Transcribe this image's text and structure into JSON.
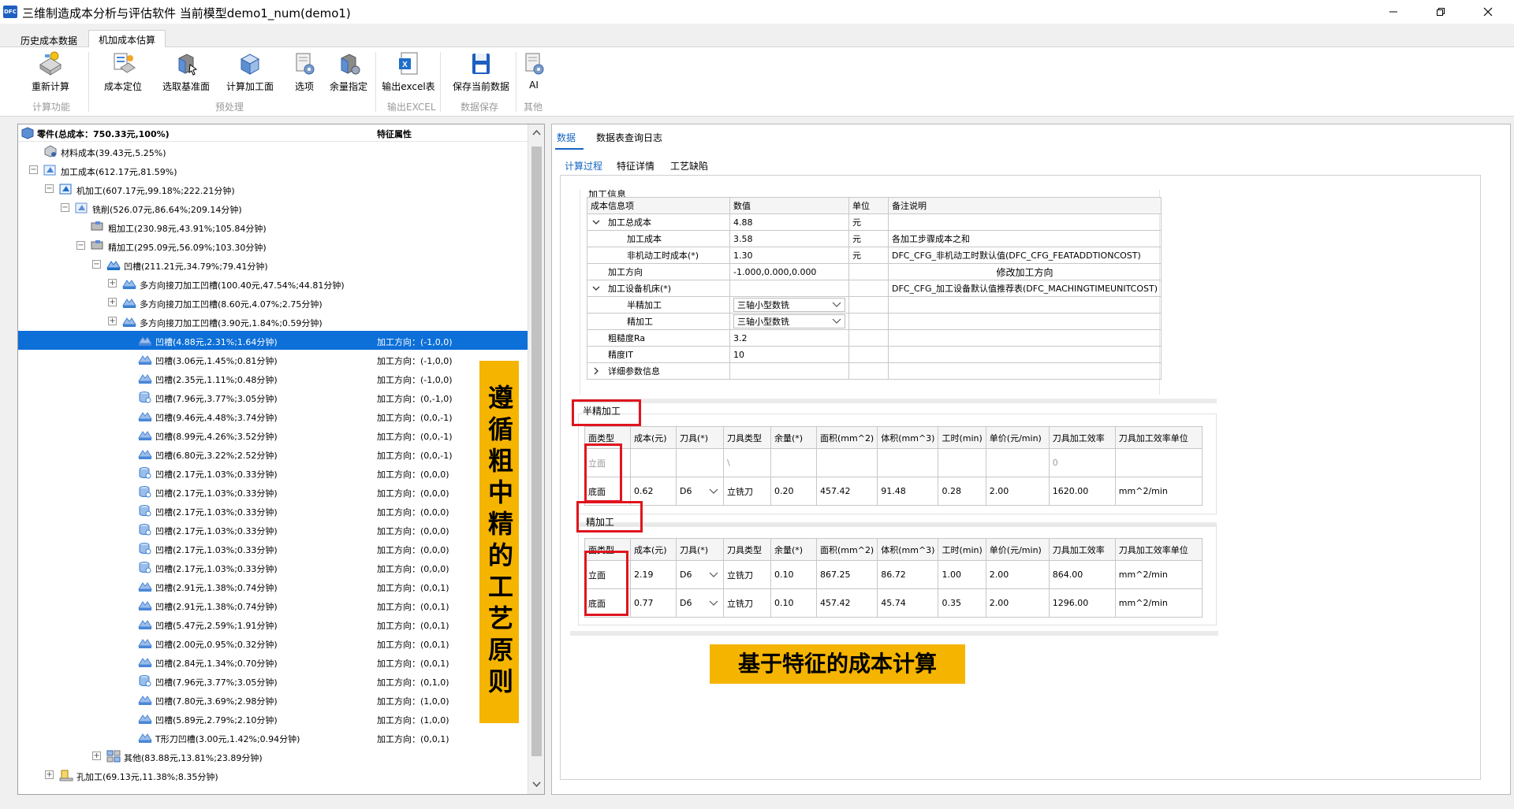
{
  "window": {
    "logo": "DFC",
    "title": "三维制造成本分析与评估软件 当前模型demo1_num(demo1)"
  },
  "tabs": [
    "历史成本数据",
    "机加成本估算"
  ],
  "ribbon": {
    "buttons": [
      {
        "label": "重新计算",
        "icon": "recalculate-icon"
      },
      {
        "label": "成本定位",
        "icon": "cost-locate-icon"
      },
      {
        "label": "选取基准面",
        "icon": "select-datum-icon"
      },
      {
        "label": "计算加工面",
        "icon": "calc-face-icon"
      },
      {
        "label": "选项",
        "icon": "options-icon"
      },
      {
        "label": "余量指定",
        "icon": "allowance-icon"
      },
      {
        "label": "输出excel表",
        "icon": "excel-icon"
      },
      {
        "label": "保存当前数据",
        "icon": "save-icon"
      },
      {
        "label": "AI",
        "icon": "ai-icon"
      }
    ],
    "groups": [
      "计算功能",
      "预处理",
      "输出EXCEL",
      "数据保存",
      "其他"
    ]
  },
  "tree": {
    "header_col1": "零件(总成本：750.33元,100%)",
    "header_col2": "特征属性",
    "rows": [
      {
        "label": "材料成本(39.43元,5.25%)",
        "attr": "",
        "exp": ""
      },
      {
        "label": "加工成本(612.17元,81.59%)",
        "attr": "",
        "exp": "−"
      },
      {
        "label": "机加工(607.17元,99.18%;222.21分钟)",
        "attr": "",
        "exp": "−"
      },
      {
        "label": "铣削(526.07元,86.64%;209.14分钟)",
        "attr": "",
        "exp": "−"
      },
      {
        "label": "粗加工(230.98元,43.91%;105.84分钟)",
        "attr": "",
        "exp": ""
      },
      {
        "label": "精加工(295.09元,56.09%;103.30分钟)",
        "attr": "",
        "exp": "−"
      },
      {
        "label": "凹槽(211.21元,34.79%;79.41分钟)",
        "attr": "",
        "exp": "−"
      },
      {
        "label": "多方向接刀加工凹槽(100.40元,47.54%;44.81分钟)",
        "attr": "",
        "exp": "+"
      },
      {
        "label": "多方向接刀加工凹槽(8.60元,4.07%;2.75分钟)",
        "attr": "",
        "exp": "+"
      },
      {
        "label": "多方向接刀加工凹槽(3.90元,1.84%;0.59分钟)",
        "attr": "",
        "exp": "+"
      },
      {
        "label": "凹槽(4.88元,2.31%;1.64分钟)",
        "attr": "加工方向：(-1,0,0)",
        "exp": ""
      },
      {
        "label": "凹槽(3.06元,1.45%;0.81分钟)",
        "attr": "加工方向：(-1,0,0)",
        "exp": ""
      },
      {
        "label": "凹槽(2.35元,1.11%;0.48分钟)",
        "attr": "加工方向：(-1,0,0)",
        "exp": ""
      },
      {
        "label": "凹槽(7.96元,3.77%;3.05分钟)",
        "attr": "加工方向：(0,-1,0)",
        "exp": ""
      },
      {
        "label": "凹槽(9.46元,4.48%;3.74分钟)",
        "attr": "加工方向：(0,0,-1)",
        "exp": ""
      },
      {
        "label": "凹槽(8.99元,4.26%;3.52分钟)",
        "attr": "加工方向：(0,0,-1)",
        "exp": ""
      },
      {
        "label": "凹槽(6.80元,3.22%;2.52分钟)",
        "attr": "加工方向：(0,0,-1)",
        "exp": ""
      },
      {
        "label": "凹槽(2.17元,1.03%;0.33分钟)",
        "attr": "加工方向：(0,0,0)",
        "exp": ""
      },
      {
        "label": "凹槽(2.17元,1.03%;0.33分钟)",
        "attr": "加工方向：(0,0,0)",
        "exp": ""
      },
      {
        "label": "凹槽(2.17元,1.03%;0.33分钟)",
        "attr": "加工方向：(0,0,0)",
        "exp": ""
      },
      {
        "label": "凹槽(2.17元,1.03%;0.33分钟)",
        "attr": "加工方向：(0,0,0)",
        "exp": ""
      },
      {
        "label": "凹槽(2.17元,1.03%;0.33分钟)",
        "attr": "加工方向：(0,0,0)",
        "exp": ""
      },
      {
        "label": "凹槽(2.17元,1.03%;0.33分钟)",
        "attr": "加工方向：(0,0,0)",
        "exp": ""
      },
      {
        "label": "凹槽(2.91元,1.38%;0.74分钟)",
        "attr": "加工方向：(0,0,1)",
        "exp": ""
      },
      {
        "label": "凹槽(2.91元,1.38%;0.74分钟)",
        "attr": "加工方向：(0,0,1)",
        "exp": ""
      },
      {
        "label": "凹槽(5.47元,2.59%;1.91分钟)",
        "attr": "加工方向：(0,0,1)",
        "exp": ""
      },
      {
        "label": "凹槽(2.00元,0.95%;0.32分钟)",
        "attr": "加工方向：(0,0,1)",
        "exp": ""
      },
      {
        "label": "凹槽(2.84元,1.34%;0.70分钟)",
        "attr": "加工方向：(0,0,1)",
        "exp": ""
      },
      {
        "label": "凹槽(7.96元,3.77%;3.05分钟)",
        "attr": "加工方向：(0,1,0)",
        "exp": ""
      },
      {
        "label": "凹槽(7.80元,3.69%;2.98分钟)",
        "attr": "加工方向：(1,0,0)",
        "exp": ""
      },
      {
        "label": "凹槽(5.89元,2.79%;2.10分钟)",
        "attr": "加工方向：(1,0,0)",
        "exp": ""
      },
      {
        "label": "T形刀凹槽(3.00元,1.42%;0.94分钟)",
        "attr": "加工方向：(0,0,1)",
        "exp": ""
      },
      {
        "label": "其他(83.88元,13.81%;23.89分钟)",
        "attr": "",
        "exp": "+"
      },
      {
        "label": "孔加工(69.13元,11.38%;8.35分钟)",
        "attr": "",
        "exp": "+"
      }
    ]
  },
  "annotations": {
    "vertical": "遵循粗中精的工艺原则",
    "bottom": "基于特征的成本计算"
  },
  "right": {
    "tabs": [
      "数据",
      "数据表查询日志"
    ],
    "subtabs": [
      "计算过程",
      "特征详情",
      "工艺缺陷"
    ],
    "info_title": "加工信息",
    "info_headers": [
      "成本信息项",
      "数值",
      "单位",
      "备注说明"
    ],
    "info_rows": [
      {
        "name": "加工总成本",
        "value": "4.88",
        "unit": "元",
        "note": "",
        "indent": 1,
        "chev": "v"
      },
      {
        "name": "加工成本",
        "value": "3.58",
        "unit": "元",
        "note": "各加工步骤成本之和",
        "indent": 2,
        "chev": ""
      },
      {
        "name": "非机动工时成本(*)",
        "value": "1.30",
        "unit": "元",
        "note": "DFC_CFG_非机动工时默认值(DFC_CFG_FEATADDTIONCOST)",
        "indent": 2,
        "chev": ""
      },
      {
        "name": "加工方向",
        "value": "-1.000,0.000,0.000",
        "unit": "",
        "note": "修改加工方向",
        "indent": 1,
        "chev": ""
      },
      {
        "name": "加工设备机床(*)",
        "value": "",
        "unit": "",
        "note": "DFC_CFG_加工设备默认值推荐表(DFC_MACHINGTIMEUNITCOST)",
        "indent": 1,
        "chev": "v"
      },
      {
        "name": "半精加工",
        "value": "三轴小型数铣",
        "unit": "",
        "note": "",
        "indent": 2,
        "chev": ""
      },
      {
        "name": "精加工",
        "value": "三轴小型数铣",
        "unit": "",
        "note": "",
        "indent": 2,
        "chev": ""
      },
      {
        "name": "粗糙度Ra",
        "value": "3.2",
        "unit": "",
        "note": "",
        "indent": 1,
        "chev": ""
      },
      {
        "name": "精度IT",
        "value": "10",
        "unit": "",
        "note": "",
        "indent": 1,
        "chev": ""
      },
      {
        "name": "详细参数信息",
        "value": "",
        "unit": "",
        "note": "",
        "indent": 1,
        "chev": ">"
      }
    ],
    "semi_title": "半精加工",
    "fine_title": "精加工",
    "proc_headers": [
      "面类型",
      "成本(元)",
      "刀具(*)",
      "刀具类型",
      "余量(*)",
      "面积(mm^2)",
      "体积(mm^3)",
      "工时(min)",
      "单价(元/min)",
      "刀具加工效率",
      "刀具加工效率单位"
    ],
    "semi_rows": [
      [
        "立面",
        "",
        "",
        "\\",
        "",
        "",
        "",
        "",
        "",
        "0",
        ""
      ],
      [
        "底面",
        "0.62",
        "D6",
        "立铣刀",
        "0.20",
        "457.42",
        "91.48",
        "0.28",
        "2.00",
        "1620.00",
        "mm^2/min"
      ]
    ],
    "fine_rows": [
      [
        "立面",
        "2.19",
        "D6",
        "立铣刀",
        "0.10",
        "867.25",
        "86.72",
        "1.00",
        "2.00",
        "864.00",
        "mm^2/min"
      ],
      [
        "底面",
        "0.77",
        "D6",
        "立铣刀",
        "0.10",
        "457.42",
        "45.74",
        "0.35",
        "2.00",
        "1296.00",
        "mm^2/min"
      ]
    ]
  }
}
